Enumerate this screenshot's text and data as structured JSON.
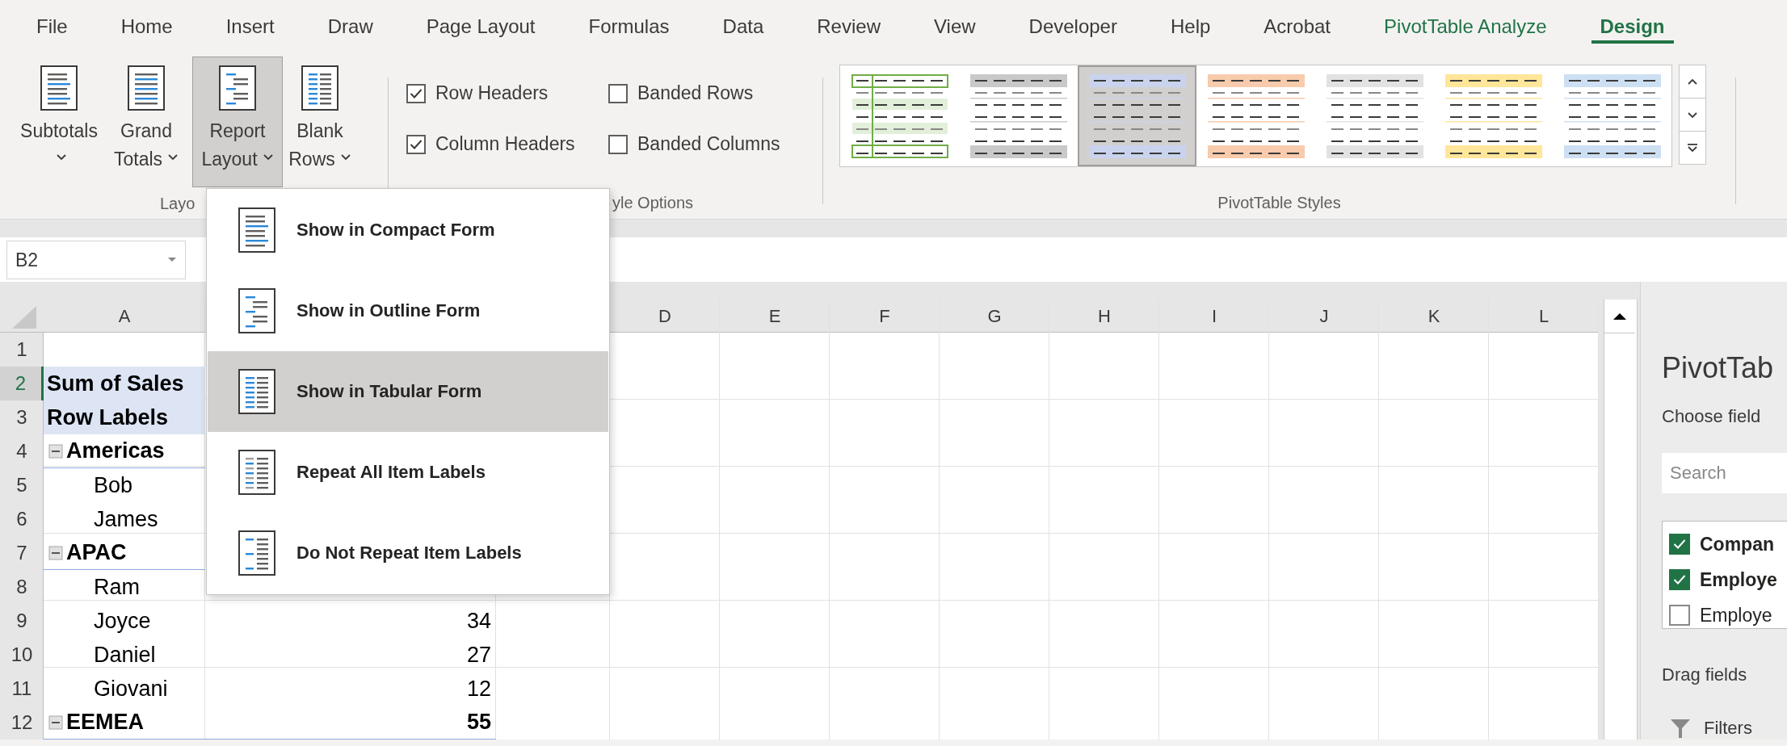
{
  "ribbon_tabs": [
    {
      "label": "File",
      "selected": false,
      "contextual": false
    },
    {
      "label": "Home",
      "selected": false,
      "contextual": false
    },
    {
      "label": "Insert",
      "selected": false,
      "contextual": false
    },
    {
      "label": "Draw",
      "selected": false,
      "contextual": false
    },
    {
      "label": "Page Layout",
      "selected": false,
      "contextual": false
    },
    {
      "label": "Formulas",
      "selected": false,
      "contextual": false
    },
    {
      "label": "Data",
      "selected": false,
      "contextual": false
    },
    {
      "label": "Review",
      "selected": false,
      "contextual": false
    },
    {
      "label": "View",
      "selected": false,
      "contextual": false
    },
    {
      "label": "Developer",
      "selected": false,
      "contextual": false
    },
    {
      "label": "Help",
      "selected": false,
      "contextual": false
    },
    {
      "label": "Acrobat",
      "selected": false,
      "contextual": false
    },
    {
      "label": "PivotTable Analyze",
      "selected": false,
      "contextual": true
    },
    {
      "label": "Design",
      "selected": true,
      "contextual": true
    }
  ],
  "ribbon": {
    "layout_group": {
      "label": "Layo",
      "buttons": [
        {
          "label": "Subtotals",
          "pressed": false
        },
        {
          "label": "Grand Totals",
          "pressed": false
        },
        {
          "label": "Report Layout",
          "pressed": true
        },
        {
          "label": "Blank Rows",
          "pressed": false
        }
      ]
    },
    "style_options_group": {
      "label": "yle Options",
      "checkboxes": [
        {
          "label": "Row Headers",
          "checked": true
        },
        {
          "label": "Banded Rows",
          "checked": false
        },
        {
          "label": "Column Headers",
          "checked": true
        },
        {
          "label": "Banded Columns",
          "checked": false
        }
      ]
    },
    "styles_group": {
      "label": "PivotTable Styles",
      "styles": [
        {
          "kind": "outlined",
          "color": "#70ad47",
          "selected": false
        },
        {
          "kind": "banded",
          "color": "#c9c9c9",
          "selected": false
        },
        {
          "kind": "banded",
          "color": "#c9d3ee",
          "selected": true
        },
        {
          "kind": "banded",
          "color": "#f8cbad",
          "selected": false
        },
        {
          "kind": "banded",
          "color": "#e2e2e2",
          "selected": false
        },
        {
          "kind": "banded",
          "color": "#ffe699",
          "selected": false
        },
        {
          "kind": "banded",
          "color": "#cddff2",
          "selected": false
        }
      ]
    }
  },
  "name_box": {
    "value": "B2"
  },
  "sheet": {
    "columns": [
      "A",
      "D",
      "E",
      "F",
      "G",
      "H",
      "I",
      "J",
      "K",
      "L"
    ],
    "rows": [
      {
        "number": "1",
        "selected": false,
        "kind": "empty"
      },
      {
        "number": "2",
        "selected": true,
        "kind": "header",
        "label": "Sum of Sales"
      },
      {
        "number": "3",
        "selected": false,
        "kind": "header",
        "label": "Row Labels"
      },
      {
        "number": "4",
        "selected": false,
        "kind": "group",
        "label": "Americas"
      },
      {
        "number": "5",
        "selected": false,
        "kind": "item",
        "label": "Bob"
      },
      {
        "number": "6",
        "selected": false,
        "kind": "item",
        "label": "James"
      },
      {
        "number": "7",
        "selected": false,
        "kind": "group",
        "label": "APAC"
      },
      {
        "number": "8",
        "selected": false,
        "kind": "item",
        "label": "Ram"
      },
      {
        "number": "9",
        "selected": false,
        "kind": "item",
        "label": "Joyce",
        "value": "34"
      },
      {
        "number": "10",
        "selected": false,
        "kind": "item",
        "label": "Daniel",
        "value": "27"
      },
      {
        "number": "11",
        "selected": false,
        "kind": "item",
        "label": "Giovani",
        "value": "12"
      },
      {
        "number": "12",
        "selected": false,
        "kind": "group",
        "label": "EEMEA",
        "value": "55"
      }
    ]
  },
  "report_layout_menu": {
    "items": [
      {
        "label": "Show in Compact Form",
        "selected": false
      },
      {
        "label": "Show in Outline Form",
        "selected": false
      },
      {
        "label": "Show in Tabular Form",
        "selected": true
      },
      {
        "label": "Repeat All Item Labels",
        "selected": false
      },
      {
        "label": "Do Not Repeat Item Labels",
        "selected": false
      }
    ]
  },
  "pivot_pane": {
    "title": "PivotTab",
    "subtitle": "Choose field",
    "search": {
      "placeholder": "Search"
    },
    "fields": [
      {
        "label": "Compan",
        "checked": true
      },
      {
        "label": "Employe",
        "checked": true
      },
      {
        "label": "Employe",
        "checked": false
      }
    ],
    "drag_hint": "Drag fields",
    "areas": [
      {
        "label": "Filters"
      }
    ]
  }
}
